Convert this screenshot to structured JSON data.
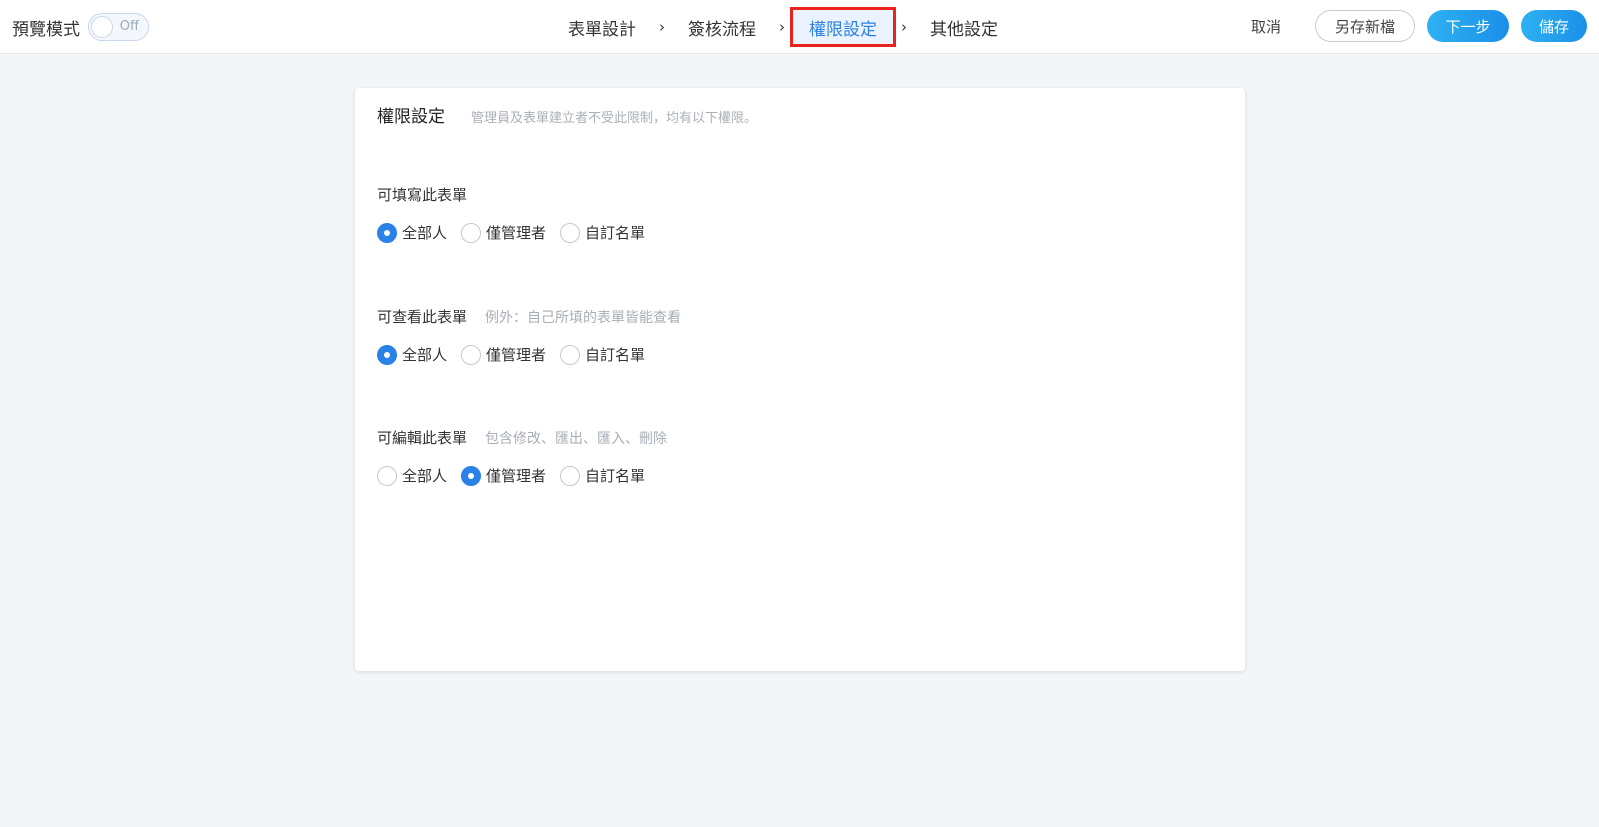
{
  "preview": {
    "label": "預覽模式",
    "toggle_text": "Off"
  },
  "steps": [
    {
      "label": "表單設計"
    },
    {
      "label": "簽核流程"
    },
    {
      "label": "權限設定"
    },
    {
      "label": "其他設定"
    }
  ],
  "actions": {
    "cancel": "取消",
    "save_as": "另存新檔",
    "next": "下一步",
    "save": "儲存"
  },
  "colors": {
    "accent": "#2b82e6",
    "highlight_border": "#e8241d"
  },
  "card": {
    "title": "權限設定",
    "description": "管理員及表單建立者不受此限制，均有以下權限。",
    "sections": [
      {
        "title": "可填寫此表單",
        "note": "",
        "options": [
          "全部人",
          "僅管理者",
          "自訂名單"
        ],
        "selected": "全部人"
      },
      {
        "title": "可查看此表單",
        "note": "例外：自己所填的表單皆能查看",
        "options": [
          "全部人",
          "僅管理者",
          "自訂名單"
        ],
        "selected": "全部人"
      },
      {
        "title": "可編輯此表單",
        "note": "包含修改、匯出、匯入、刪除",
        "options": [
          "全部人",
          "僅管理者",
          "自訂名單"
        ],
        "selected": "僅管理者"
      }
    ]
  }
}
